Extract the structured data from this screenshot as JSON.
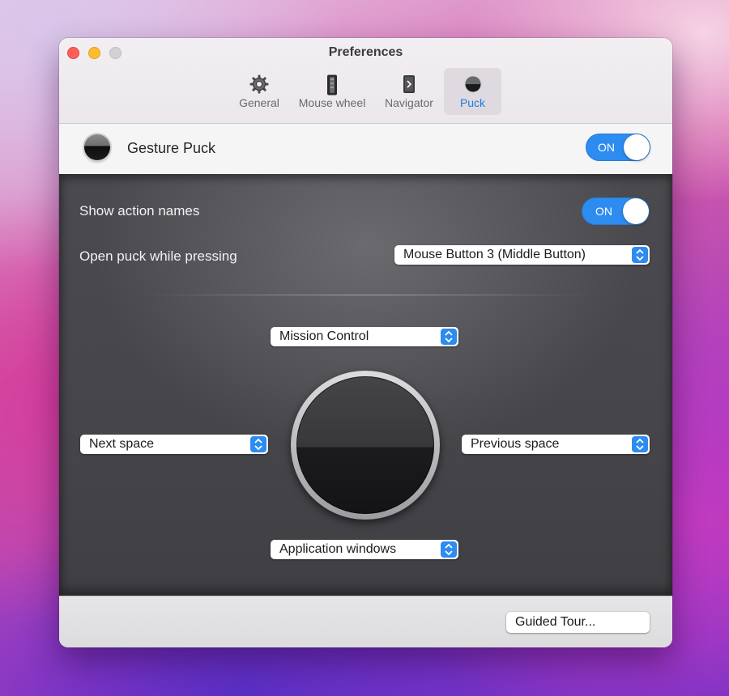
{
  "window": {
    "title": "Preferences"
  },
  "tabs": [
    {
      "label": "General",
      "icon": "gear-icon",
      "active": false
    },
    {
      "label": "Mouse wheel",
      "icon": "mouse-wheel-icon",
      "active": false
    },
    {
      "label": "Navigator",
      "icon": "navigator-icon",
      "active": false
    },
    {
      "label": "Puck",
      "icon": "puck-icon",
      "active": true
    }
  ],
  "header": {
    "title": "Gesture Puck",
    "toggle_label": "ON",
    "toggle_on": true
  },
  "settings": {
    "show_action_names": {
      "label": "Show action names",
      "toggle_label": "ON",
      "toggle_on": true
    },
    "open_puck": {
      "label": "Open puck while pressing",
      "value": "Mouse Button 3 (Middle Button)"
    }
  },
  "puck": {
    "top": "Mission Control",
    "left": "Next space",
    "right": "Previous space",
    "bottom": "Application windows"
  },
  "footer": {
    "guided_tour_label": "Guided Tour..."
  },
  "colors": {
    "accent": "#2d8cf0",
    "panel": "#48484d"
  }
}
